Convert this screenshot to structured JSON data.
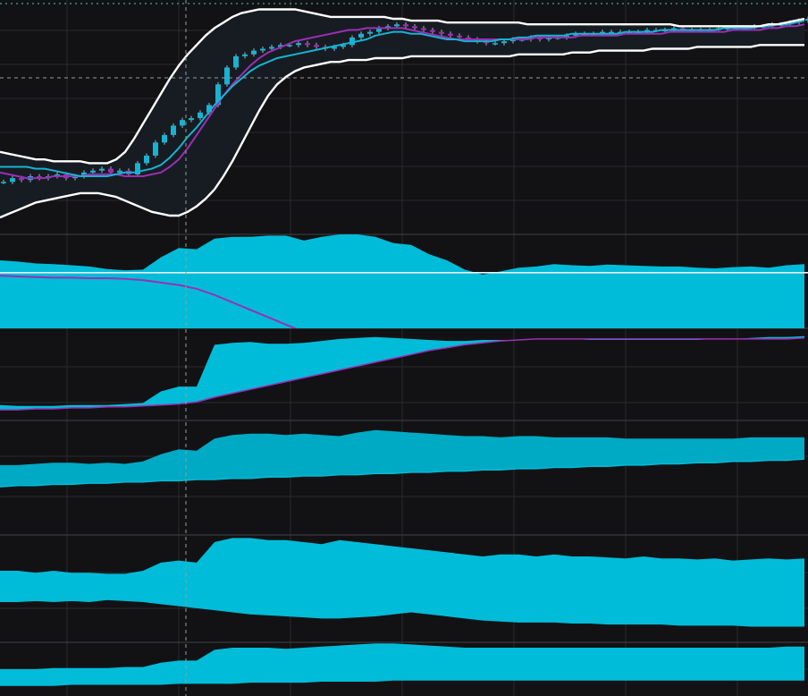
{
  "colors": {
    "background": "#121214",
    "grid": "#2a2a2e",
    "band": "#ffffff",
    "band_fill": "#171c22",
    "fast_ma": "#17b3d2",
    "slow_ma": "#9b2fb5",
    "candle_up": "#17b3d2",
    "candle_down": "#9b2fb5",
    "area_fill": "#00bcd8",
    "area_fill_dark": "#00a9c4",
    "crosshair": "#9a9a9a",
    "zero_line": "#e8f4f8",
    "top_dotted": "#3fd0c8"
  },
  "chart_data": [
    {
      "type": "candlestick",
      "panel": "price",
      "grid": true,
      "x": [
        0,
        10,
        20,
        30,
        40,
        50,
        60,
        70,
        80,
        90,
        100,
        110,
        120,
        130,
        140,
        150,
        160,
        170,
        180,
        190,
        200,
        210,
        220,
        230,
        240,
        250,
        260,
        270,
        280,
        290,
        300,
        310,
        320,
        330,
        340,
        350,
        360,
        370,
        380,
        390,
        400,
        410,
        420,
        430,
        440,
        450,
        460,
        470,
        480,
        490,
        500,
        510,
        520,
        530,
        540,
        550,
        560,
        570,
        580,
        590,
        600,
        610,
        620,
        630,
        640,
        650,
        660,
        670,
        680,
        690,
        700,
        710,
        720,
        730,
        740,
        750,
        760,
        770,
        780,
        790,
        800,
        810,
        820,
        830,
        840,
        850,
        860,
        870,
        880,
        890,
        900
      ],
      "close": [
        58,
        60,
        59,
        61,
        60,
        61,
        62,
        60,
        61,
        63,
        64,
        65,
        63,
        64,
        62,
        68,
        72,
        79,
        83,
        88,
        91,
        92,
        95,
        99,
        110,
        119,
        125,
        126,
        128,
        129,
        130,
        131,
        131,
        132,
        131,
        130,
        129,
        130,
        131,
        135,
        137,
        138,
        140,
        141,
        142,
        141,
        140,
        139,
        138,
        137,
        136,
        135,
        134,
        133,
        132,
        132,
        133,
        134,
        134,
        135,
        134,
        135,
        135,
        136,
        137,
        137,
        137,
        138,
        138,
        138,
        138,
        138,
        139,
        139,
        139,
        140,
        139,
        139,
        139,
        139,
        140,
        140,
        140,
        140,
        141,
        141,
        142,
        142,
        143,
        144,
        145
      ],
      "series": [
        {
          "name": "",
          "kind": "upper_band",
          "values": [
            74,
            73,
            72,
            71,
            70,
            70,
            69,
            69,
            69,
            69,
            68,
            68,
            68,
            70,
            74,
            81,
            89,
            97,
            105,
            113,
            120,
            126,
            131,
            136,
            140,
            143,
            146,
            148,
            149,
            150,
            150,
            150,
            150,
            150,
            149,
            148,
            147,
            146,
            146,
            146,
            146,
            146,
            146,
            146,
            145,
            145,
            144,
            144,
            144,
            144,
            143,
            143,
            143,
            143,
            143,
            143,
            143,
            143,
            143,
            142,
            142,
            142,
            142,
            142,
            142,
            142,
            142,
            142,
            142,
            142,
            142,
            142,
            142,
            142,
            142,
            142,
            141,
            141,
            141,
            141,
            141,
            141,
            141,
            141,
            141,
            141,
            142,
            142,
            143,
            144,
            145
          ]
        },
        {
          "name": "",
          "kind": "lower_band",
          "values": [
            39,
            41,
            43,
            45,
            47,
            48,
            49,
            50,
            51,
            52,
            52,
            52,
            51,
            50,
            48,
            46,
            44,
            42,
            41,
            40,
            40,
            42,
            45,
            49,
            54,
            61,
            69,
            78,
            87,
            96,
            104,
            110,
            114,
            117,
            119,
            120,
            121,
            122,
            122,
            123,
            123,
            123,
            124,
            124,
            124,
            124,
            125,
            125,
            125,
            125,
            125,
            125,
            125,
            125,
            125,
            125,
            125,
            125,
            126,
            126,
            126,
            126,
            126,
            126,
            127,
            127,
            127,
            128,
            128,
            128,
            128,
            128,
            128,
            129,
            129,
            129,
            129,
            129,
            130,
            130,
            130,
            130,
            130,
            130,
            130,
            131,
            131,
            131,
            131,
            131,
            131
          ]
        },
        {
          "name": "",
          "kind": "fast_ma",
          "values": [
            66,
            66,
            66,
            66,
            65,
            65,
            64,
            63,
            62,
            61,
            61,
            61,
            61,
            62,
            63,
            63,
            64,
            65,
            67,
            71,
            76,
            82,
            87,
            93,
            99,
            104,
            109,
            113,
            117,
            120,
            122,
            124,
            125,
            126,
            127,
            128,
            129,
            130,
            131,
            132,
            133,
            134,
            136,
            137,
            138,
            138,
            137,
            137,
            136,
            135,
            134,
            134,
            133,
            133,
            133,
            133,
            134,
            134,
            135,
            135,
            136,
            136,
            136,
            136,
            137,
            137,
            137,
            137,
            137,
            137,
            138,
            138,
            138,
            138,
            139,
            139,
            139,
            139,
            139,
            139,
            139,
            140,
            140,
            140,
            140,
            141,
            141,
            142,
            142,
            143,
            144
          ]
        },
        {
          "name": "",
          "kind": "slow_ma",
          "values": [
            63,
            62,
            61,
            60,
            60,
            60,
            61,
            61,
            61,
            61,
            62,
            62,
            62,
            62,
            61,
            61,
            61,
            62,
            63,
            66,
            70,
            76,
            83,
            90,
            97,
            104,
            110,
            115,
            120,
            124,
            127,
            129,
            131,
            133,
            134,
            135,
            136,
            137,
            138,
            139,
            139,
            140,
            140,
            140,
            140,
            140,
            139,
            138,
            137,
            136,
            135,
            134,
            134,
            134,
            134,
            134,
            134,
            134,
            134,
            134,
            135,
            135,
            135,
            135,
            135,
            136,
            136,
            136,
            136,
            136,
            137,
            137,
            137,
            137,
            137,
            138,
            138,
            138,
            138,
            138,
            138,
            138,
            139,
            139,
            139,
            139,
            140,
            140,
            141,
            141,
            142
          ]
        }
      ]
    },
    {
      "type": "area",
      "panel": "oscillator",
      "grid": true,
      "x": [
        0,
        20,
        40,
        60,
        80,
        100,
        120,
        140,
        160,
        180,
        200,
        220,
        240,
        260,
        280,
        300,
        320,
        340,
        360,
        380,
        400,
        420,
        440,
        460,
        480,
        500,
        520,
        540,
        560,
        580,
        600,
        620,
        640,
        660,
        680,
        700,
        720,
        740,
        760,
        780,
        800,
        820,
        840,
        860,
        880,
        900
      ],
      "values": [
        20,
        18,
        15,
        14,
        12,
        10,
        6,
        4,
        5,
        25,
        40,
        38,
        55,
        58,
        58,
        60,
        60,
        52,
        58,
        62,
        62,
        58,
        48,
        45,
        30,
        20,
        5,
        -3,
        2,
        8,
        10,
        14,
        12,
        11,
        13,
        12,
        11,
        10,
        10,
        8,
        7,
        9,
        10,
        8,
        12,
        14
      ],
      "baseline": 0,
      "series": [
        {
          "name": "",
          "values": [
            -5,
            -6,
            -7,
            -8,
            -8,
            -9,
            -9,
            -10,
            -12,
            -16,
            -20,
            -26,
            -36,
            -48,
            -60,
            -72,
            -84,
            -96,
            -108,
            -120,
            -130,
            -140,
            -150,
            -158,
            -166,
            -172,
            -178,
            -184,
            -188,
            -192,
            -196,
            -198,
            -200,
            -202,
            -204,
            -205,
            -206,
            -207,
            -208,
            -209,
            -210,
            -210,
            -211,
            -211,
            -212,
            -212
          ]
        }
      ]
    },
    {
      "type": "area",
      "panel": "indicator_3",
      "grid": true,
      "x": [
        0,
        20,
        40,
        60,
        80,
        100,
        120,
        140,
        160,
        180,
        200,
        220,
        240,
        260,
        280,
        300,
        320,
        340,
        360,
        380,
        400,
        420,
        440,
        460,
        480,
        500,
        520,
        540,
        560,
        580,
        600,
        620,
        640,
        660,
        680,
        700,
        720,
        740,
        760,
        780,
        800,
        820,
        840,
        860,
        880,
        900
      ],
      "values": [
        6,
        5,
        5,
        5,
        6,
        6,
        6,
        7,
        8,
        20,
        25,
        25,
        68,
        70,
        71,
        69,
        69,
        70,
        72,
        74,
        75,
        76,
        75,
        74,
        73,
        72,
        72,
        73,
        73,
        73,
        74,
        74,
        74,
        73,
        73,
        73,
        73,
        73,
        73,
        73,
        74,
        74,
        75,
        76,
        76,
        77
      ],
      "series": [
        {
          "name": "",
          "values": [
            1,
            1,
            2,
            2,
            3,
            3,
            4,
            4,
            5,
            6,
            7,
            9,
            14,
            18,
            22,
            26,
            30,
            34,
            38,
            42,
            46,
            50,
            54,
            58,
            62,
            65,
            68,
            70,
            72,
            73,
            74,
            74,
            74,
            74,
            74,
            74,
            74,
            74,
            74,
            74,
            74,
            74,
            74,
            74,
            74,
            75
          ]
        }
      ]
    },
    {
      "type": "area",
      "panel": "indicator_4",
      "grid": true,
      "x": [
        0,
        20,
        40,
        60,
        80,
        100,
        120,
        140,
        160,
        180,
        200,
        220,
        240,
        260,
        280,
        300,
        320,
        340,
        360,
        380,
        400,
        420,
        440,
        460,
        480,
        500,
        520,
        540,
        560,
        580,
        600,
        620,
        640,
        660,
        680,
        700,
        720,
        740,
        760,
        780,
        800,
        820,
        840,
        860,
        880,
        900
      ],
      "values": [
        18,
        18,
        19,
        20,
        20,
        19,
        20,
        19,
        21,
        27,
        31,
        30,
        40,
        43,
        44,
        44,
        43,
        44,
        43,
        42,
        45,
        47,
        46,
        45,
        44,
        43,
        42,
        42,
        41,
        42,
        42,
        41,
        41,
        41,
        41,
        40,
        40,
        40,
        40,
        40,
        40,
        40,
        41,
        41,
        41,
        41
      ],
      "series": [
        {
          "name": "",
          "values": [
            0,
            1,
            1,
            2,
            2,
            3,
            3,
            4,
            4,
            5,
            5,
            6,
            6,
            7,
            7,
            8,
            8,
            9,
            9,
            10,
            10,
            11,
            11,
            12,
            12,
            13,
            13,
            14,
            14,
            15,
            15,
            16,
            16,
            17,
            17,
            18,
            18,
            19,
            19,
            20,
            20,
            21,
            21,
            22,
            22,
            23
          ]
        }
      ]
    },
    {
      "type": "area",
      "panel": "indicator_5",
      "grid": true,
      "x": [
        0,
        20,
        40,
        60,
        80,
        100,
        120,
        140,
        160,
        180,
        200,
        220,
        240,
        260,
        280,
        300,
        320,
        340,
        360,
        380,
        400,
        420,
        440,
        460,
        480,
        500,
        520,
        540,
        560,
        580,
        600,
        620,
        640,
        660,
        680,
        700,
        720,
        740,
        760,
        780,
        800,
        820,
        840,
        860,
        880,
        900
      ],
      "values": [
        60,
        60,
        58,
        60,
        58,
        58,
        57,
        57,
        60,
        68,
        70,
        68,
        88,
        92,
        92,
        90,
        90,
        88,
        86,
        90,
        88,
        86,
        84,
        82,
        80,
        78,
        76,
        74,
        76,
        76,
        74,
        76,
        74,
        74,
        73,
        72,
        74,
        72,
        72,
        71,
        72,
        70,
        71,
        72,
        71,
        72
      ],
      "series": [
        {
          "name": "",
          "values": [
            30,
            30,
            31,
            30,
            31,
            30,
            32,
            31,
            30,
            28,
            26,
            24,
            22,
            20,
            18,
            17,
            16,
            15,
            14,
            14,
            15,
            16,
            18,
            20,
            18,
            16,
            14,
            12,
            11,
            10,
            10,
            10,
            9,
            9,
            8,
            8,
            8,
            8,
            7,
            7,
            7,
            7,
            6,
            6,
            6,
            6
          ]
        }
      ]
    },
    {
      "type": "area",
      "panel": "indicator_6",
      "grid": true,
      "x": [
        0,
        20,
        40,
        60,
        80,
        100,
        120,
        140,
        160,
        180,
        200,
        220,
        240,
        260,
        280,
        300,
        320,
        340,
        360,
        380,
        400,
        420,
        440,
        460,
        480,
        500,
        520,
        540,
        560,
        580,
        600,
        620,
        640,
        660,
        680,
        700,
        720,
        740,
        760,
        780,
        800,
        820,
        840,
        860,
        880,
        900
      ],
      "values": [
        20,
        20,
        20,
        21,
        21,
        21,
        21,
        22,
        22,
        26,
        28,
        28,
        38,
        40,
        40,
        40,
        39,
        40,
        41,
        42,
        43,
        44,
        44,
        43,
        42,
        41,
        40,
        40,
        40,
        40,
        40,
        40,
        40,
        40,
        40,
        40,
        40,
        40,
        40,
        40,
        40,
        40,
        40,
        40,
        41,
        41
      ],
      "series": [
        {
          "name": "",
          "values": [
            5,
            5,
            5,
            5,
            6,
            6,
            6,
            6,
            6,
            6,
            7,
            7,
            7,
            7,
            8,
            8,
            8,
            8,
            9,
            9,
            9,
            9,
            10,
            10,
            10,
            10,
            10,
            10,
            10,
            10,
            10,
            10,
            10,
            10,
            10,
            10,
            10,
            10,
            10,
            10,
            10,
            10,
            10,
            10,
            10,
            10
          ]
        }
      ]
    }
  ]
}
